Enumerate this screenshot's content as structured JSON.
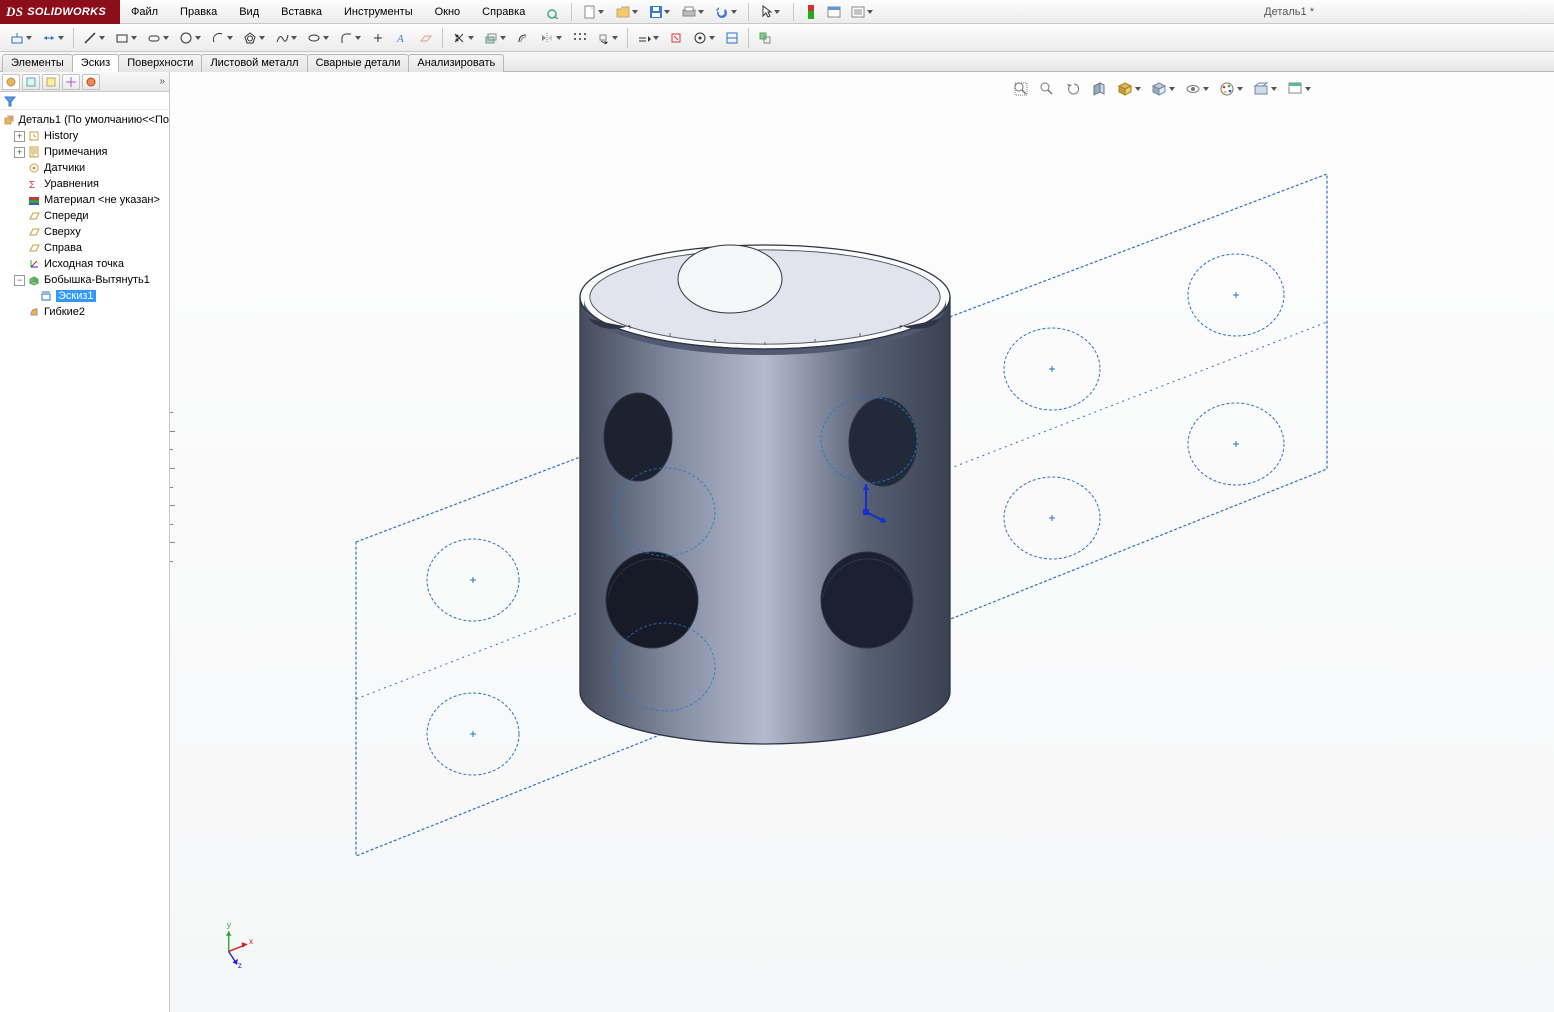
{
  "logo": {
    "brand_prefix": "DS",
    "brand": "SOLIDWORKS"
  },
  "menu": {
    "items": [
      "Файл",
      "Правка",
      "Вид",
      "Вставка",
      "Инструменты",
      "Окно",
      "Справка"
    ]
  },
  "doc_title": "Деталь1 *",
  "command_tabs": {
    "items": [
      "Элементы",
      "Эскиз",
      "Поверхности",
      "Листовой металл",
      "Сварные детали",
      "Анализировать"
    ],
    "active_index": 1
  },
  "feature_tree": {
    "root": "Деталь1  (По умолчанию<<По",
    "items": [
      {
        "label": "History",
        "icon": "history-icon",
        "indent": 1,
        "expander": "plus"
      },
      {
        "label": "Примечания",
        "icon": "notes-icon",
        "indent": 1,
        "expander": "plus"
      },
      {
        "label": "Датчики",
        "icon": "sensors-icon",
        "indent": 1,
        "expander": "none"
      },
      {
        "label": "Уравнения",
        "icon": "equations-icon",
        "indent": 1,
        "expander": "none"
      },
      {
        "label": "Материал <не указан>",
        "icon": "material-icon",
        "indent": 1,
        "expander": "none"
      },
      {
        "label": "Спереди",
        "icon": "plane-icon",
        "indent": 1,
        "expander": "none"
      },
      {
        "label": "Сверху",
        "icon": "plane-icon",
        "indent": 1,
        "expander": "none"
      },
      {
        "label": "Справа",
        "icon": "plane-icon",
        "indent": 1,
        "expander": "none"
      },
      {
        "label": "Исходная точка",
        "icon": "origin-icon",
        "indent": 1,
        "expander": "none"
      },
      {
        "label": "Бобышка-Вытянуть1",
        "icon": "extrude-icon",
        "indent": 1,
        "expander": "minus"
      },
      {
        "label": "Эскиз1",
        "icon": "sketch-icon",
        "indent": 2,
        "expander": "none",
        "selected": true
      },
      {
        "label": "Гибкие2",
        "icon": "flex-icon",
        "indent": 1,
        "expander": "none"
      }
    ]
  },
  "triad": {
    "x": "x",
    "y": "y",
    "z": "z"
  }
}
